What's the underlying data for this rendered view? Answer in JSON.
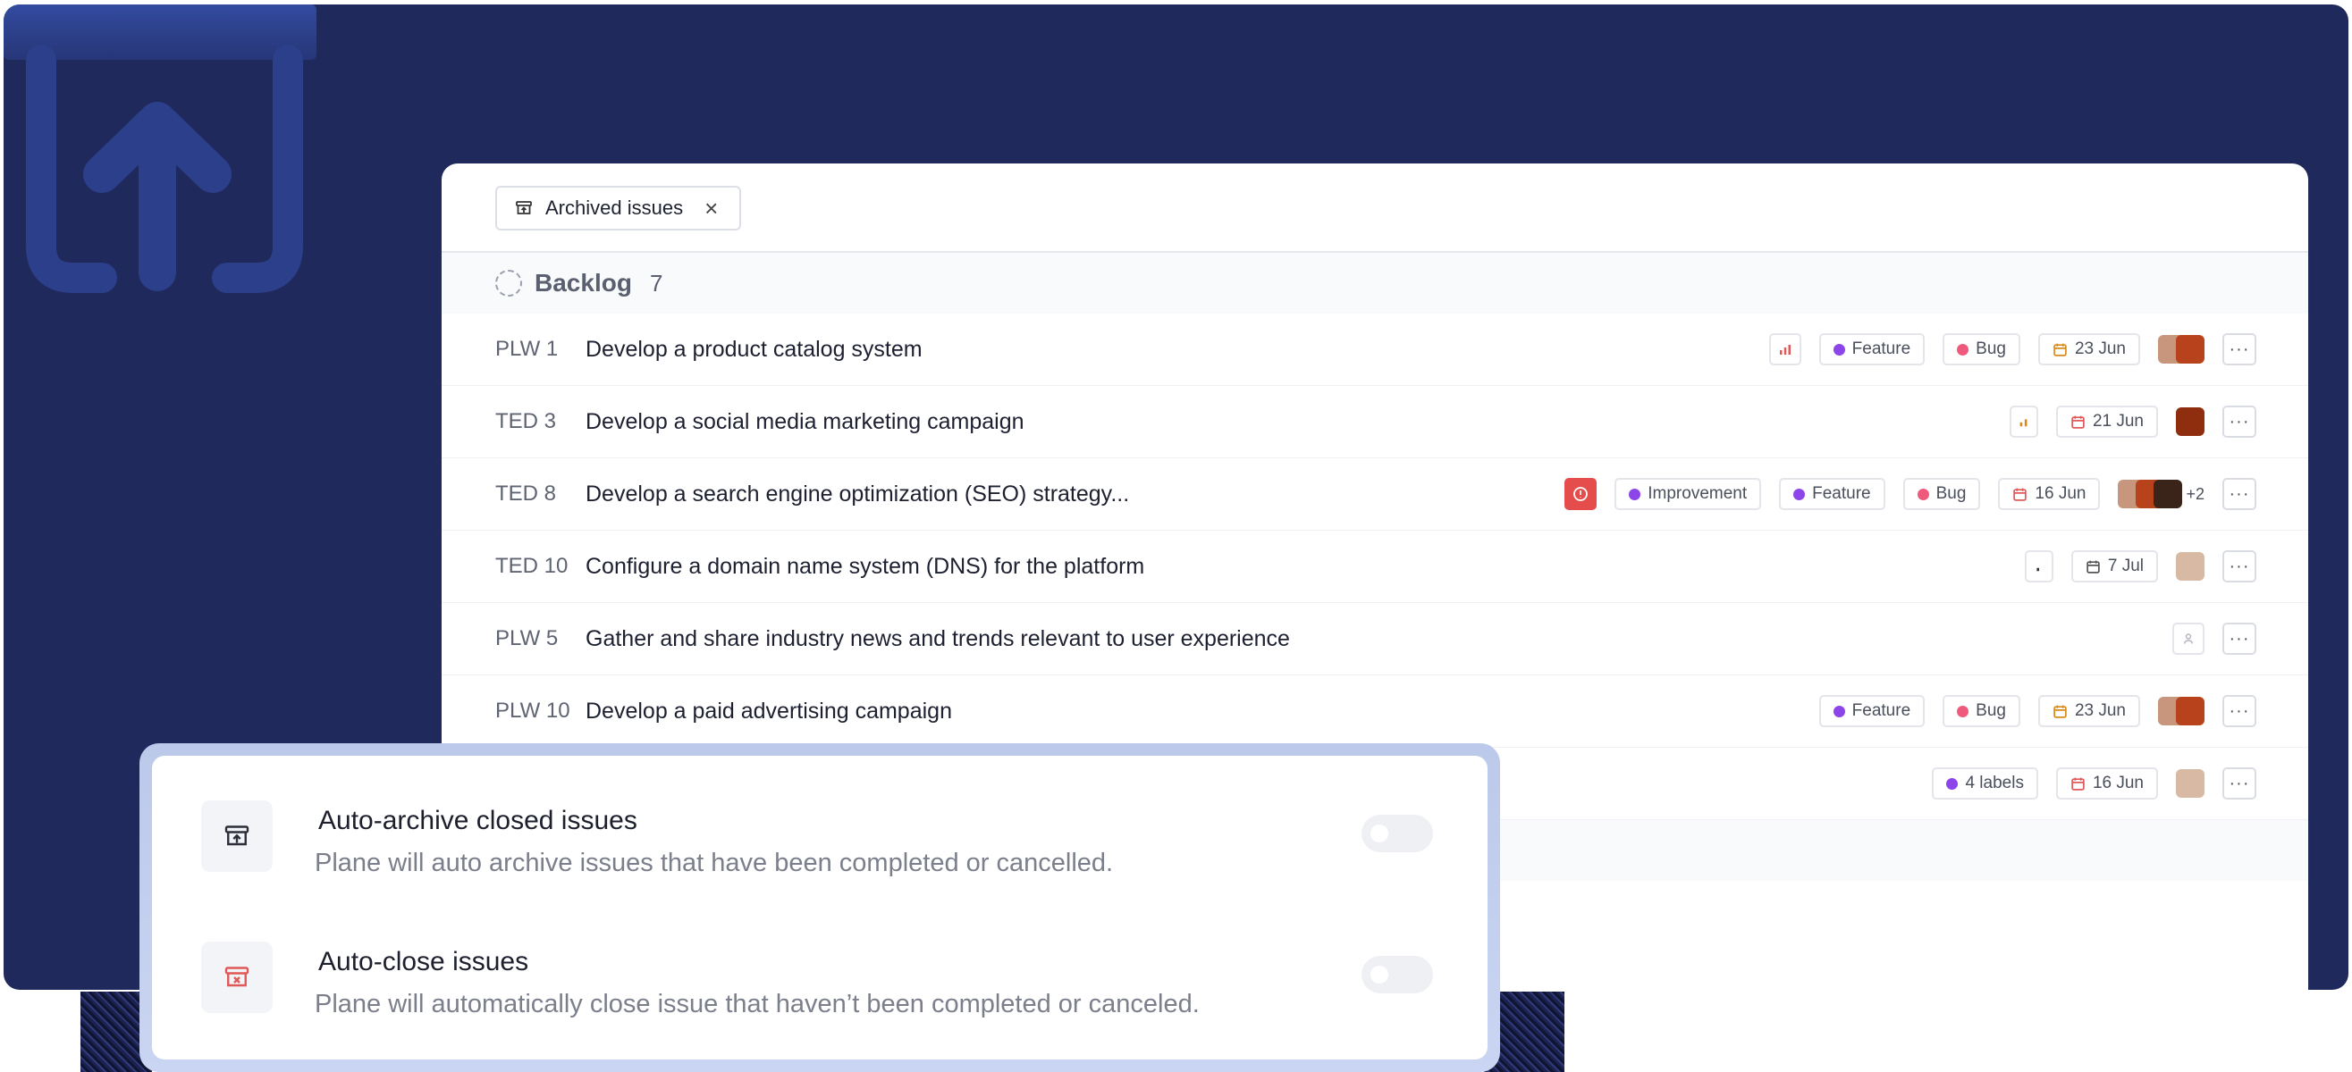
{
  "header": {
    "filter_chip": {
      "label": "Archived issues",
      "close": "×",
      "icon": "archive-icon"
    }
  },
  "group": {
    "title": "Backlog",
    "count": "7",
    "icon": "backlog-dashed-circle-icon"
  },
  "issues": [
    {
      "key": "PLW 1",
      "title": "Develop a product catalog system",
      "labels": [
        "Feature",
        "Bug"
      ],
      "due": "23 Jun"
    },
    {
      "key": "TED 3",
      "title": "Develop a social media marketing campaign",
      "due": "21 Jun"
    },
    {
      "key": "TED 8",
      "title": "Develop a search engine optimization (SEO) strategy...",
      "labels": [
        "Improvement",
        "Feature",
        "Bug"
      ],
      "due": "16 Jun",
      "extra_assignees": "+2"
    },
    {
      "key": "TED 10",
      "title": "Configure a domain name system (DNS) for the platform",
      "due": "7 Jul"
    },
    {
      "key": "PLW 5",
      "title": "Gather and share industry news and trends relevant to user experience"
    },
    {
      "key": "PLW 10",
      "title": "Develop a paid advertising campaign",
      "labels": [
        "Feature",
        "Bug"
      ],
      "due": "23 Jun"
    },
    {
      "labels_summary": "4 labels",
      "due": "16 Jun"
    }
  ],
  "more_label": "···",
  "colors": {
    "background": "#20295c",
    "feature": "#8b45e8",
    "bug": "#ef5a7c",
    "improvement": "#8b45e8",
    "urgent": "#e54d4d",
    "due_orange": "#d98b1a",
    "due_red": "#e05858"
  },
  "settings": [
    {
      "title": "Auto-archive closed issues",
      "description": "Plane will auto archive issues that have been completed or cancelled.",
      "icon": "archive-icon",
      "enabled": false
    },
    {
      "title": "Auto-close issues",
      "description": "Plane will automatically close issue that haven’t been completed or canceled.",
      "icon": "archive-x-icon",
      "enabled": false
    }
  ]
}
